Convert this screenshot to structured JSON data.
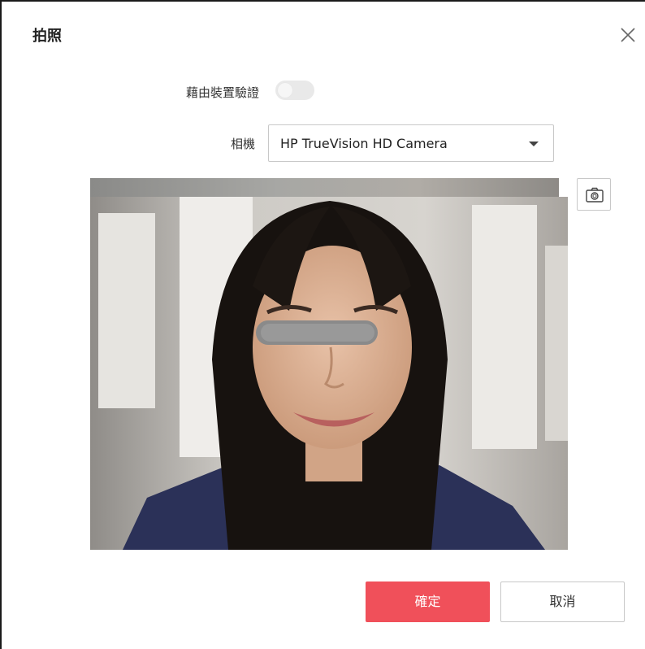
{
  "dialog": {
    "title": "拍照",
    "close_icon": "close-icon"
  },
  "device_verify": {
    "label": "藉由裝置驗證",
    "enabled": false
  },
  "camera": {
    "label": "相機",
    "selected": "HP TrueVision HD Camera"
  },
  "preview": {
    "snapshot_icon": "camera-icon"
  },
  "footer": {
    "ok_label": "確定",
    "cancel_label": "取消"
  },
  "colors": {
    "primary": "#f0505a",
    "border": "#c8c8c8"
  }
}
